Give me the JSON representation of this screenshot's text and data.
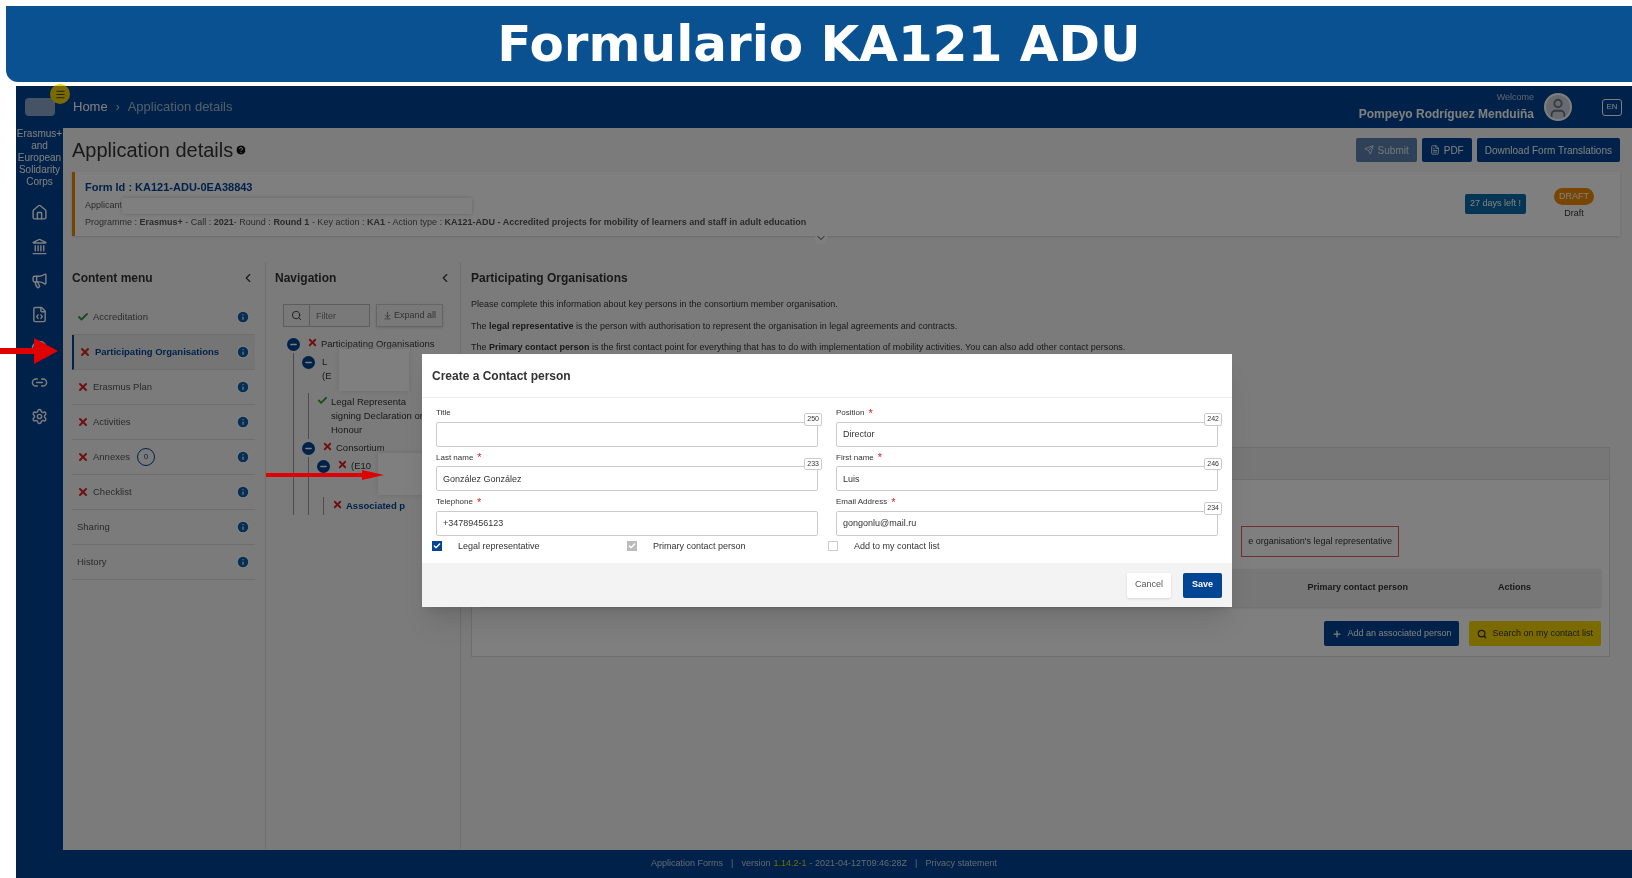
{
  "slide_title": "Formulario KA121 ADU",
  "topbar": {
    "logo_text": "Erasmus+ and European Solidarity Corps",
    "breadcrumb_separator": "›",
    "breadcrumbs": [
      {
        "label": "Home",
        "current": false
      },
      {
        "label": "Application details",
        "current": true
      }
    ],
    "welcome": "Welcome",
    "user": "Pompeyo Rodríguez Menduiña",
    "language": "EN"
  },
  "page": {
    "title": "Application details",
    "buttons": [
      {
        "label": "Submit",
        "kind": "submit",
        "disabled": true
      },
      {
        "label": "PDF",
        "kind": "pdf",
        "disabled": false
      },
      {
        "label": "Download Form Translations",
        "kind": "plain",
        "disabled": false
      }
    ]
  },
  "form_card": {
    "form_id": "Form Id : KA121-ADU-0EA38843",
    "applicant_label": "Applicant",
    "programme": "Programme : **Erasmus+** - Call : **2021**- Round : **Round 1** - Key action : **KA1** - Action type : **KA121-ADU - Accredited projects for mobility of learners and staff in adult education**",
    "deadline": "27 days left !",
    "status_badge": "DRAFT",
    "status": "Draft"
  },
  "content_menu": {
    "title": "Content menu",
    "items": [
      {
        "label": "Accreditation",
        "valid": true,
        "selected": false
      },
      {
        "label": "Participating Organisations",
        "valid": false,
        "selected": true
      },
      {
        "label": "Erasmus Plan",
        "valid": false,
        "selected": false
      },
      {
        "label": "Activities",
        "valid": false,
        "selected": false
      },
      {
        "label": "Annexes",
        "valid": false,
        "selected": false,
        "count": "0"
      },
      {
        "label": "Checklist",
        "valid": false,
        "selected": false
      },
      {
        "label": "Sharing",
        "selected": false
      },
      {
        "label": "History",
        "selected": false
      }
    ]
  },
  "navigation": {
    "title": "Navigation",
    "filter_placeholder": "Filter",
    "expand_all": "Expand all",
    "tree": [
      {
        "lines": [
          "Participating Organisations"
        ],
        "valid": false,
        "expanded": true,
        "children": [
          {
            "lines": [
              "L",
              "(E"
            ],
            "expanded": true,
            "redacted": true,
            "children": [
              {
                "lines": [
                  "Legal Representa",
                  "signing Declaration or",
                  "Honour"
                ],
                "valid": true
              }
            ]
          },
          {
            "lines": [
              "Consortium"
            ],
            "valid": false,
            "expanded": true,
            "children": [
              {
                "lines": [
                  "(E10"
                ],
                "valid": false,
                "expanded": true,
                "redacted": true,
                "children": [
                  {
                    "lines": [
                      "Associated p"
                    ],
                    "valid": false,
                    "link": true
                  }
                ]
              }
            ]
          }
        ]
      }
    ]
  },
  "main": {
    "title": "Participating Organisations",
    "paragraphs": [
      "Please complete this information about key persons in the consortium member organisation.",
      "The **legal representative** is the person with authorisation to represent the organisation in legal agreements and contracts.",
      "The **Primary contact person** is the first contact point for everything that has to do with implementation of mobility activities. You can also add other contact persons."
    ],
    "warning": "e organisation's legal representative",
    "columns": [
      "Primary contact person",
      "Actions"
    ],
    "buttons": [
      {
        "label": "Add an associated person",
        "kind": "add"
      },
      {
        "label": "Search on my contact list",
        "kind": "search"
      }
    ]
  },
  "modal": {
    "title": "Create a Contact person",
    "required_mark": "*",
    "fields": [
      {
        "label": "Title",
        "required": false,
        "counter": "250"
      },
      {
        "label": "Position",
        "required": true,
        "counter": "242",
        "value": "Director"
      },
      {
        "label": "Last name",
        "required": true,
        "counter": "233",
        "value": "González González"
      },
      {
        "label": "First name",
        "required": true,
        "counter": "246",
        "value": "Luis"
      },
      {
        "label": "Telephone",
        "required": true,
        "value": "+34789456123"
      },
      {
        "label": "Email Address",
        "required": true,
        "counter": "234",
        "value": "gongonlu@mail.ru"
      }
    ],
    "checkboxes": [
      {
        "label": "Legal representative",
        "checked": true,
        "disabled": false
      },
      {
        "label": "Primary contact person",
        "checked": true,
        "disabled": true
      },
      {
        "label": "Add to my contact list",
        "checked": false,
        "disabled": false
      }
    ],
    "cancel": "Cancel",
    "save": "Save"
  },
  "footer": {
    "app": "Application Forms",
    "separator": "|",
    "version_label": "version",
    "version": "1.14.2-1",
    "timestamp": "- 2021-04-12T09:46:28Z",
    "privacy": "Privacy statement"
  }
}
